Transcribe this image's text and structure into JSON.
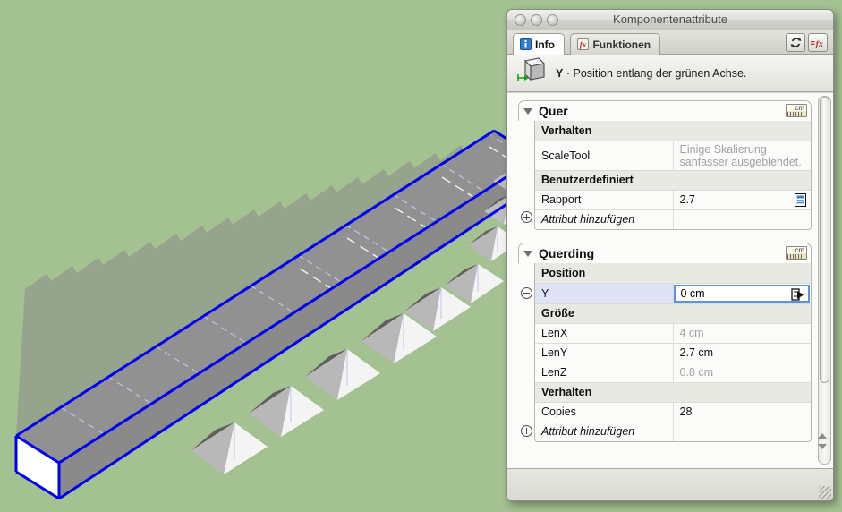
{
  "viewport": {
    "name": "sketchup-3d-viewport",
    "background_color": "#a3c191",
    "model_fill": "#919191",
    "model_top_fill": "#8f8f8f",
    "model_end_fill": "#ffffff",
    "selection_color": "#0000f0",
    "hidden_edge_color": "#b9c4e8",
    "description": "Selected long rectangular beam component with 28 repeated cone-shaped cutouts along its length"
  },
  "window": {
    "title": "Komponentenattribute",
    "traffic_lights": [
      "close-button",
      "minimize-button",
      "zoom-button"
    ],
    "tabs": [
      {
        "label": "Info",
        "icon": "info-icon",
        "active": true
      },
      {
        "label": "Funktionen",
        "icon": "function-fx-icon",
        "active": false
      }
    ],
    "toolbar": [
      {
        "name": "refresh-button",
        "icon": "refresh-icon"
      },
      {
        "name": "formula-button",
        "icon": "equals-fx-icon"
      }
    ],
    "infobar": {
      "icon": "component-cube-icon",
      "key": "Y",
      "separator": "·",
      "text": "Position entlang der grünen Achse."
    }
  },
  "groups": [
    {
      "name": "group-quer",
      "title": "Quer",
      "collapsed": false,
      "units_badge": "cm",
      "rows": [
        {
          "type": "section",
          "label": "Verhalten"
        },
        {
          "type": "row",
          "key": "ScaleTool",
          "value": "Einige Skalierung sanfasser ausgeblendet.",
          "value_dim": true,
          "multiline": true
        },
        {
          "type": "section",
          "label": "Benutzerdefiniert"
        },
        {
          "type": "row",
          "key": "Rapport",
          "value": "2.7",
          "value_dim": false,
          "value_icon": "list-options-icon"
        },
        {
          "type": "add",
          "key": "Attribut hinzufügen",
          "value": "",
          "gutter": "plus-expander-icon"
        }
      ]
    },
    {
      "name": "group-querding",
      "title": "Querding",
      "collapsed": false,
      "units_badge": "cm",
      "rows": [
        {
          "type": "section",
          "label": "Position"
        },
        {
          "type": "edit",
          "key": "Y",
          "key_color": "green",
          "value": "0 cm",
          "selected": true,
          "gutter": "minus-expander-icon",
          "field_icon": "value-options-arrow-icon"
        },
        {
          "type": "section",
          "label": "Größe"
        },
        {
          "type": "row",
          "key": "LenX",
          "key_color": "red",
          "value": "4 cm",
          "value_dim": true
        },
        {
          "type": "row",
          "key": "LenY",
          "key_color": "green",
          "value": "2.7 cm",
          "value_dim": false
        },
        {
          "type": "row",
          "key": "LenZ",
          "key_color": "blue",
          "value": "0.8 cm",
          "value_dim": true
        },
        {
          "type": "section",
          "label": "Verhalten"
        },
        {
          "type": "row",
          "key": "Copies",
          "value": "28",
          "value_dim": false
        },
        {
          "type": "add",
          "key": "Attribut hinzufügen",
          "value": "",
          "gutter": "plus-expander-icon"
        }
      ]
    }
  ],
  "scrollbar": {
    "name": "vertical-scrollbar",
    "thumb_position_pct": 0,
    "thumb_size_pct": 78
  }
}
